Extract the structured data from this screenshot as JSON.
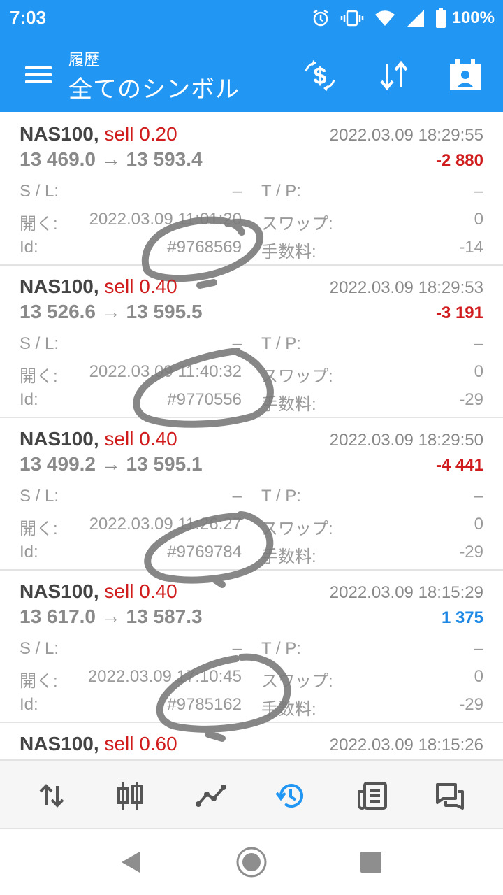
{
  "status_bar": {
    "time": "7:03",
    "battery": "100%"
  },
  "app_bar": {
    "subtitle": "履歴",
    "title": "全てのシンボル"
  },
  "labels": {
    "sl": "S / L:",
    "tp": "T / P:",
    "open": "開く:",
    "swap": "スワップ:",
    "id": "Id:",
    "commission": "手数料:"
  },
  "trades": [
    {
      "symbol": "NAS100,",
      "side": "sell 0.20",
      "close_time": "2022.03.09 18:29:55",
      "prices": "13 469.0 → 13 593.4",
      "profit": "-2 880",
      "sl": "–",
      "tp": "–",
      "open_time": "2022.03.09 11:01:20",
      "swap": "0",
      "id": "#9768569",
      "commission": "-14"
    },
    {
      "symbol": "NAS100,",
      "side": "sell 0.40",
      "close_time": "2022.03.09 18:29:53",
      "prices": "13 526.6 → 13 595.5",
      "profit": "-3 191",
      "sl": "–",
      "tp": "–",
      "open_time": "2022.03.09 11:40:32",
      "swap": "0",
      "id": "#9770556",
      "commission": "-29"
    },
    {
      "symbol": "NAS100,",
      "side": "sell 0.40",
      "close_time": "2022.03.09 18:29:50",
      "prices": "13 499.2 → 13 595.1",
      "profit": "-4 441",
      "sl": "–",
      "tp": "–",
      "open_time": "2022.03.09 11:26:27",
      "swap": "0",
      "id": "#9769784",
      "commission": "-29"
    },
    {
      "symbol": "NAS100,",
      "side": "sell 0.40",
      "close_time": "2022.03.09 18:15:29",
      "prices": "13 617.0 → 13 587.3",
      "profit": "1 375",
      "sl": "–",
      "tp": "–",
      "open_time": "2022.03.09 17:10:45",
      "swap": "0",
      "id": "#9785162",
      "commission": "-29"
    },
    {
      "symbol": "NAS100,",
      "side": "sell 0.60",
      "close_time": "2022.03.09 18:15:26",
      "prices": "",
      "profit": "",
      "sl": "",
      "tp": "",
      "open_time": "",
      "swap": "",
      "id": "",
      "commission": ""
    }
  ],
  "bottom_nav": {
    "active": "history",
    "items": [
      "quotes",
      "chart",
      "trade",
      "history",
      "news",
      "messages"
    ]
  },
  "colors": {
    "primary": "#2196F3",
    "loss": "#d01c1c",
    "gain": "#1e88e5",
    "scribble": "#7a7a7a"
  }
}
